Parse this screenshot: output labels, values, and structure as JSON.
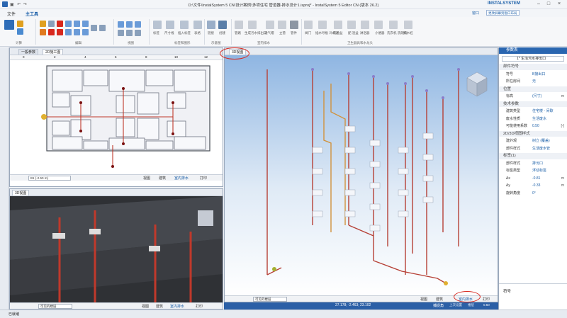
{
  "window": {
    "title": "D:\\文件\\InstalSystem 5 CN\\设计案例\\多项住宅 管道器-排水设计1.isproj* - InstalSystem 5 Editor CN (版本 26.2)",
    "brand": "INSTALSYSTEM",
    "window_menu": "窗口",
    "switch_label": "更改屏幕到窗口布局"
  },
  "menu": {
    "tabs": [
      "文件",
      "主工具"
    ]
  },
  "ribbon": {
    "groups": [
      "计算",
      "编辑",
      "视图",
      "标签和图形",
      "示意图",
      "室内排水",
      "卫生器具和水龙头"
    ],
    "tools": [
      "标签",
      "尺寸线",
      "插入标签",
      "表格",
      "链接",
      "创建",
      "管路",
      "生成污水排出口",
      "通气帽",
      "立管",
      "管件",
      "阀门",
      "插水导板 冷却池",
      "洗脸盆",
      "配 浴盆",
      "淋浴器",
      "小便器",
      "洗衣机 洗碗机",
      "排水桩"
    ]
  },
  "panel_top_left": {
    "tabs": [
      "一般参数",
      "2D施工图"
    ],
    "ruler": [
      "0",
      "2",
      "4",
      "6",
      "8",
      "10",
      "12"
    ],
    "level": "B1 (-2.50 m)",
    "views": [
      "视图",
      "建筑",
      "室内排水",
      "打印"
    ]
  },
  "panel_bottom_left": {
    "tabs": [
      "3D视图"
    ],
    "level": "可见的楼层",
    "views": [
      "视图",
      "建筑",
      "室内排水",
      "打印"
    ]
  },
  "panel_3d": {
    "tab": "3D视图",
    "level": "可见的楼层",
    "views": [
      "视图",
      "建筑",
      "室内排水",
      "打印"
    ],
    "coords": "27.178; -2.463; 23.102",
    "snap": "捕捉角",
    "grid_label": "上次设置",
    "layer_label": "楼层",
    "unit": "0.50"
  },
  "properties": {
    "title": "参数表",
    "object": "1* 生活污水排出口",
    "rows": [
      {
        "type": "sec",
        "k": "部件符号"
      },
      {
        "k": "符号",
        "v": "B接出口",
        "u": ""
      },
      {
        "k": "所在房间",
        "v": "无",
        "u": ""
      },
      {
        "type": "sec",
        "k": "位置"
      },
      {
        "k": "标高",
        "v": "(尺寸)",
        "u": "m"
      },
      {
        "type": "sec",
        "k": "技术参数"
      },
      {
        "k": "建筑类型",
        "v": "住宅楼 - 间歇",
        "u": ""
      },
      {
        "k": "废水性质",
        "v": "生活废水",
        "u": ""
      },
      {
        "k": "可能使用系数",
        "v": "0.50",
        "u": "[-]"
      },
      {
        "type": "sec",
        "k": "2D/3D视图样式"
      },
      {
        "k": "建外观",
        "v": "树立 (覆盖)",
        "u": ""
      },
      {
        "k": "部件样式",
        "v": "生活废水管",
        "u": ""
      },
      {
        "type": "sec",
        "k": "标签(1)"
      },
      {
        "k": "部件样式",
        "v": "排污口",
        "u": ""
      },
      {
        "k": "标签类型",
        "v": "浮动标签",
        "u": ""
      },
      {
        "k": "Δx",
        "v": "-0.81",
        "u": "m"
      },
      {
        "k": "Δy",
        "v": "-0.33",
        "u": "m"
      },
      {
        "k": "旋转角度",
        "v": "0°",
        "u": ""
      }
    ],
    "footer": "符号"
  },
  "statusbar": {
    "left": "已就绪"
  },
  "colors": {
    "accent": "#2b5fa6",
    "pipe": "#c0392b",
    "highlight": "#d8281e"
  }
}
